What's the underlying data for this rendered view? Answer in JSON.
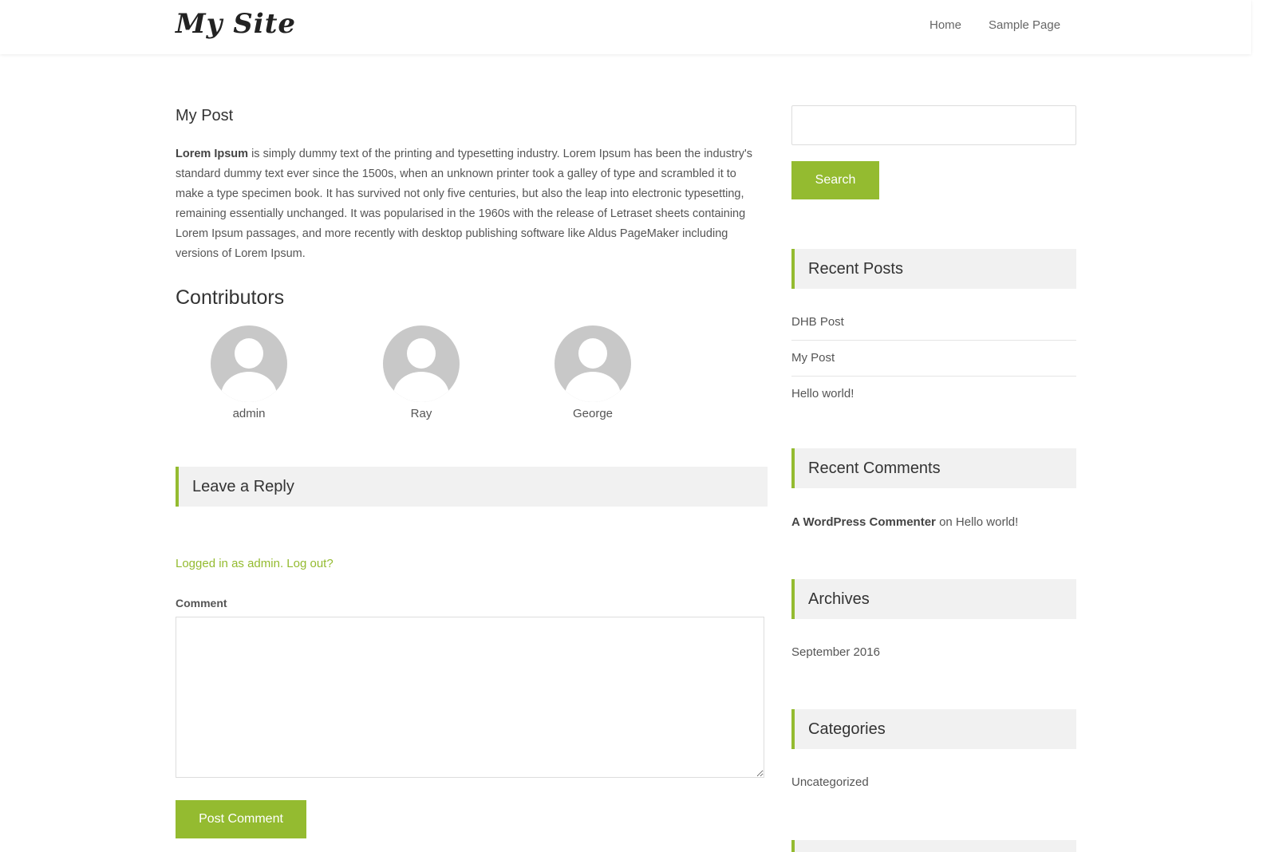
{
  "site": {
    "title": "My Site"
  },
  "nav": {
    "items": [
      "Home",
      "Sample Page"
    ]
  },
  "post": {
    "title": "My Post",
    "body_bold": "Lorem Ipsum",
    "body_rest": " is simply dummy text of the printing and typesetting industry. Lorem Ipsum has been the industry's standard dummy text ever since the 1500s, when an unknown printer took a galley of type and scrambled it to make a type specimen book. It has survived not only five centuries, but also the leap into electronic typesetting, remaining essentially unchanged. It was popularised in the 1960s with the release of Letraset sheets containing Lorem Ipsum passages, and more recently with desktop publishing software like Aldus PageMaker including versions of Lorem Ipsum."
  },
  "contributors": {
    "title": "Contributors",
    "names": [
      "admin",
      "Ray",
      "George"
    ]
  },
  "reply": {
    "title": "Leave a Reply",
    "logged_in_text": "Logged in as admin",
    "logout_text": "Log out?",
    "comment_label": "Comment",
    "submit_label": "Post Comment"
  },
  "sidebar": {
    "search": {
      "placeholder": "",
      "button_label": "Search"
    },
    "recent_posts": {
      "title": "Recent Posts",
      "items": [
        "DHB Post",
        "My Post",
        "Hello world!"
      ]
    },
    "recent_comments": {
      "title": "Recent Comments",
      "author": "A WordPress Commenter",
      "on": "on",
      "post": "Hello world!"
    },
    "archives": {
      "title": "Archives",
      "items": [
        "September 2016"
      ]
    },
    "categories": {
      "title": "Categories",
      "items": [
        "Uncategorized"
      ]
    }
  },
  "colors": {
    "accent": "#94bb30",
    "widget_bg": "#f1f1f1"
  }
}
